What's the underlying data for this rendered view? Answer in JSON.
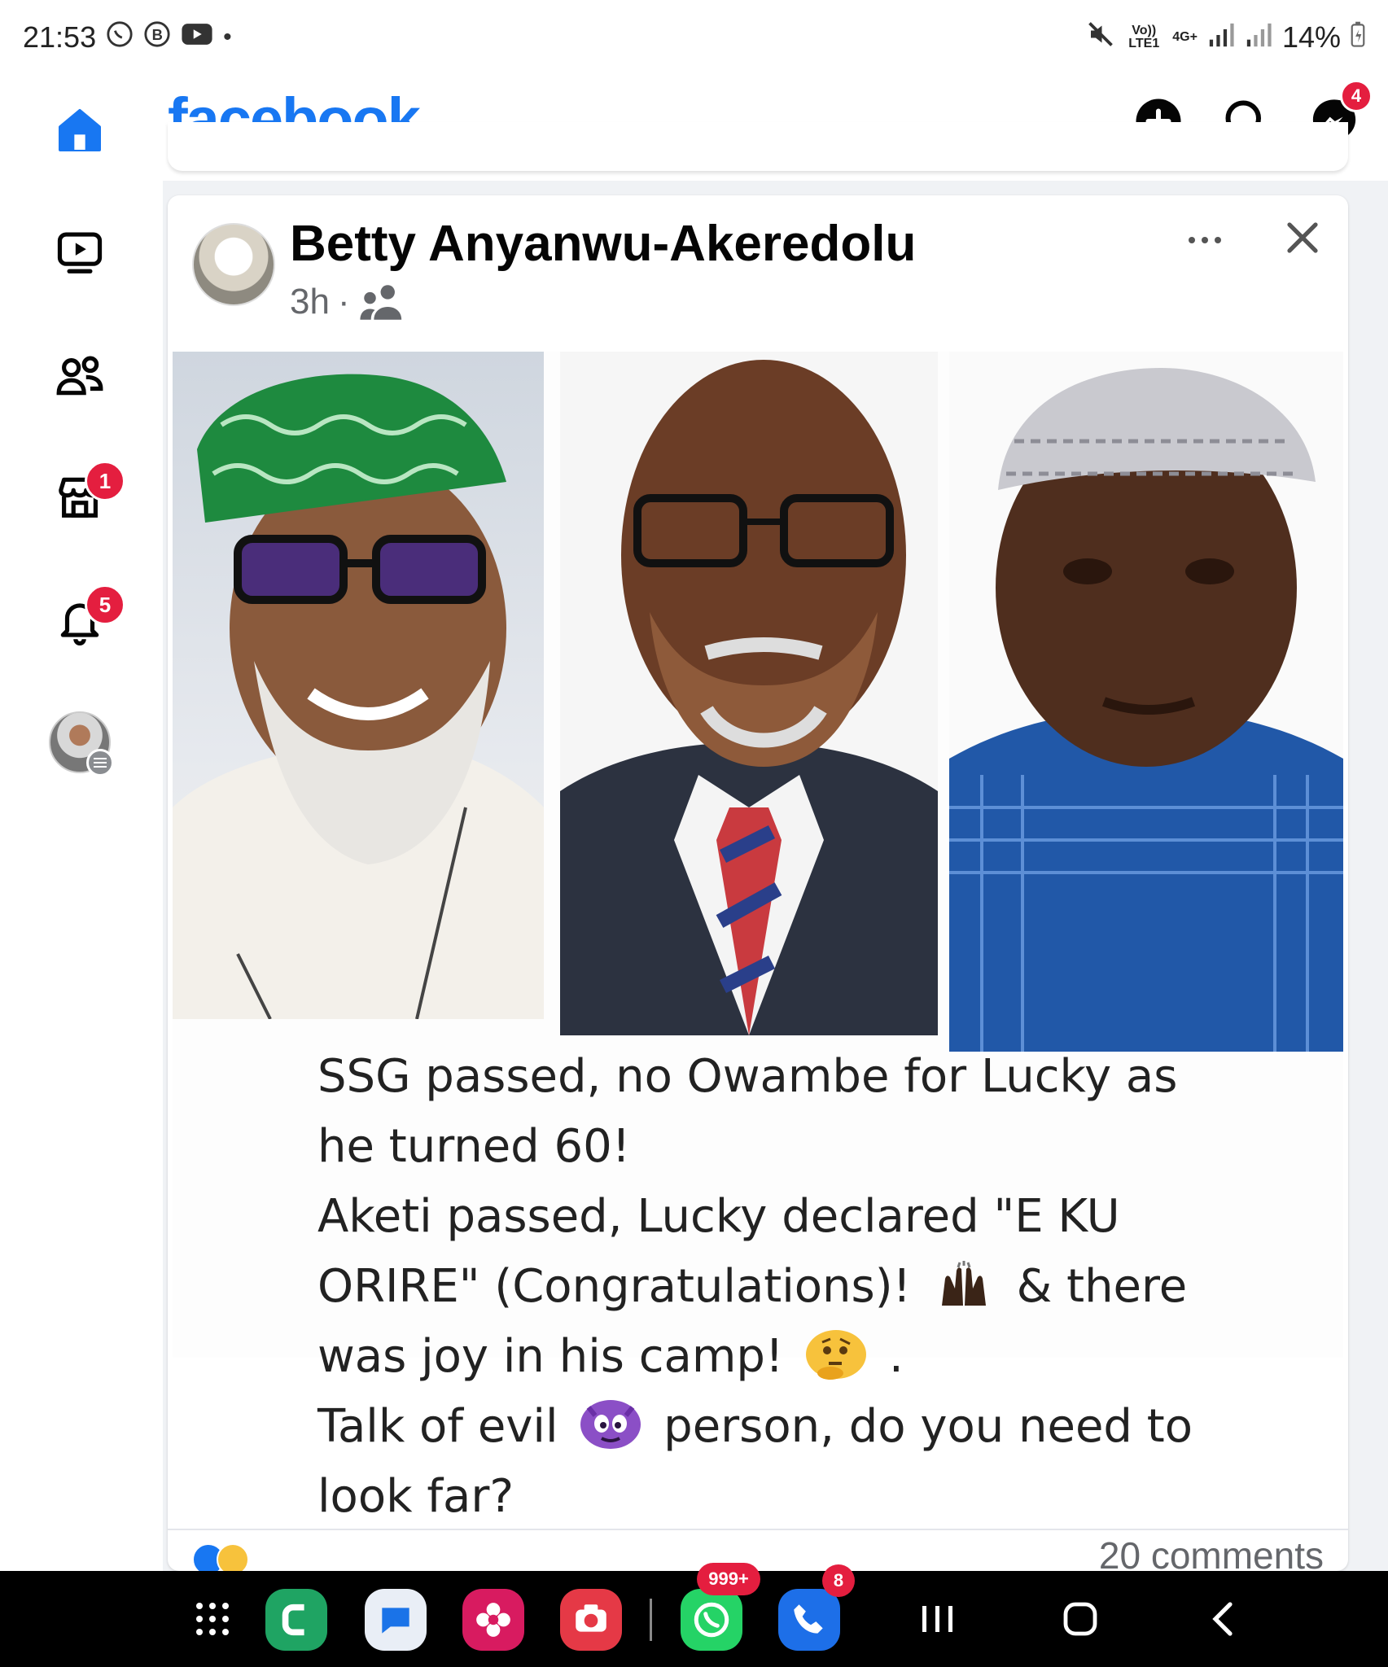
{
  "status_bar": {
    "time": "21:53",
    "volte": "Vo)) LTE1",
    "network": "4G+",
    "battery": "14%"
  },
  "app": {
    "logo": "facebook",
    "messenger_badge": "4"
  },
  "sidebar": {
    "marketplace_badge": "1",
    "notifications_badge": "5"
  },
  "post": {
    "author": "Betty Anyanwu-Akeredolu",
    "time": "3h",
    "separator": "·",
    "caption_lines": [
      "SSG passed, no Owambe for Lucky as",
      "he turned 60!",
      "Aketi passed, Lucky declared \"E KU",
      "ORIRE\" (Congratulations)!",
      "& there",
      "was joy in his camp!",
      ".",
      "Talk of evil",
      "person, do you need to",
      "look far?"
    ],
    "comments": "20 comments"
  },
  "dock": {
    "whatsapp_badge": "999+",
    "phone_badge": "8"
  },
  "colors": {
    "brand": "#1877f2",
    "badge": "#e41e3f"
  }
}
